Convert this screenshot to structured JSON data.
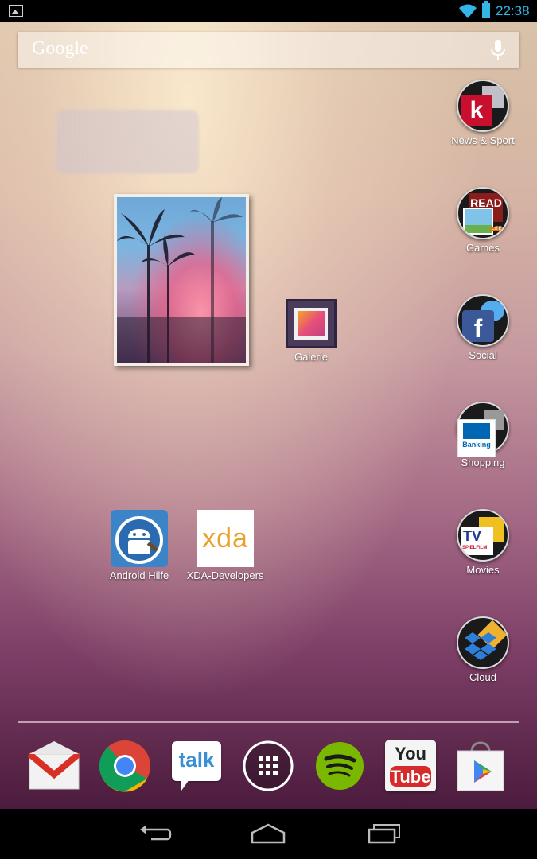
{
  "status_bar": {
    "time": "22:38",
    "accent_color": "#33b5e5",
    "icons": [
      "gallery-notification-icon",
      "wifi-icon",
      "battery-icon"
    ]
  },
  "search": {
    "logo_text": "Google",
    "icons": [
      "mic-icon"
    ]
  },
  "home": {
    "widget": {
      "type": "photo-frame"
    },
    "shortcuts": [
      {
        "label": "Galerie",
        "icon": "gallery-icon"
      },
      {
        "label": "Android Hilfe",
        "icon": "android-hilfe-icon"
      },
      {
        "label": "XDA-Developers",
        "icon": "xda-icon",
        "icon_text": "xda"
      }
    ],
    "folders": [
      {
        "label": "News & Sport",
        "badge_letter": "k"
      },
      {
        "label": "Games",
        "badge_text": "READ",
        "sub_badge": "LITE"
      },
      {
        "label": "Social",
        "badge_letter": "f"
      },
      {
        "label": "Shopping",
        "badge_text": "Banking"
      },
      {
        "label": "Movies",
        "badge_text": "TV",
        "sub_badge": "SPIELFILM"
      },
      {
        "label": "Cloud",
        "icon": "dropbox-icon"
      }
    ]
  },
  "dock": {
    "apps": [
      {
        "name": "Gmail",
        "icon": "gmail-icon"
      },
      {
        "name": "Chrome",
        "icon": "chrome-icon"
      },
      {
        "name": "Talk",
        "icon": "talk-icon",
        "text": "talk"
      },
      {
        "name": "Apps",
        "icon": "app-drawer-icon"
      },
      {
        "name": "Spotify",
        "icon": "spotify-icon"
      },
      {
        "name": "YouTube",
        "icon": "youtube-icon",
        "text_top": "You",
        "text_bottom": "Tube"
      },
      {
        "name": "Play Store",
        "icon": "play-store-icon"
      }
    ]
  },
  "nav_bar": {
    "buttons": [
      "back-icon",
      "home-icon",
      "recents-icon"
    ]
  }
}
